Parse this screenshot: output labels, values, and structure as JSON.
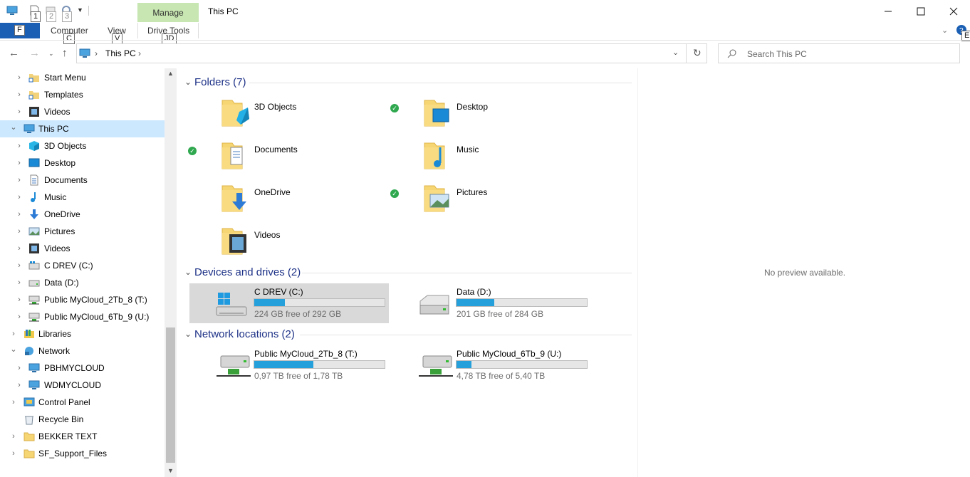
{
  "title_bar": {
    "title": "This PC",
    "manage_tab": "Manage",
    "qat_keytips": [
      "1",
      "2",
      "3"
    ],
    "window_controls": [
      "minimize-icon",
      "maximize-icon",
      "close-icon"
    ]
  },
  "ribbon": {
    "file_keytip": "F",
    "tabs": [
      {
        "label": "Computer",
        "keytip": "C"
      },
      {
        "label": "View",
        "keytip": "V"
      },
      {
        "label": "Drive Tools",
        "keytip": "JD"
      }
    ],
    "help_keytip": "E"
  },
  "address_bar": {
    "path": [
      "This PC"
    ],
    "search_placeholder": "Search This PC"
  },
  "nav_pane": {
    "items": [
      {
        "label": "Start Menu",
        "icon": "shortcut-folder-icon"
      },
      {
        "label": "Templates",
        "icon": "shortcut-folder-icon"
      },
      {
        "label": "Videos",
        "icon": "videos-icon"
      },
      {
        "label": "This PC",
        "icon": "computer-icon",
        "selected": true,
        "expanded": true
      },
      {
        "label": "3D Objects",
        "icon": "3d-objects-icon"
      },
      {
        "label": "Desktop",
        "icon": "desktop-icon"
      },
      {
        "label": "Documents",
        "icon": "documents-icon"
      },
      {
        "label": "Music",
        "icon": "music-icon"
      },
      {
        "label": "OneDrive",
        "icon": "onedrive-download-icon"
      },
      {
        "label": "Pictures",
        "icon": "pictures-icon"
      },
      {
        "label": "Videos",
        "icon": "videos-icon"
      },
      {
        "label": "C DREV (C:)",
        "icon": "windows-drive-icon"
      },
      {
        "label": "Data (D:)",
        "icon": "drive-icon"
      },
      {
        "label": "Public MyCloud_2Tb_8 (T:)",
        "icon": "network-drive-icon"
      },
      {
        "label": "Public MyCloud_6Tb_9 (U:)",
        "icon": "network-drive-icon"
      },
      {
        "label": "Libraries",
        "icon": "libraries-icon"
      },
      {
        "label": "Network",
        "icon": "network-icon",
        "expanded": true
      },
      {
        "label": "PBHMYCLOUD",
        "icon": "computer-icon"
      },
      {
        "label": "WDMYCLOUD",
        "icon": "computer-icon"
      },
      {
        "label": "Control Panel",
        "icon": "control-panel-icon"
      },
      {
        "label": "Recycle Bin",
        "icon": "recycle-bin-icon"
      },
      {
        "label": "BEKKER TEXT",
        "icon": "folder-icon"
      },
      {
        "label": "SF_Support_Files",
        "icon": "folder-icon"
      }
    ]
  },
  "content": {
    "folders_header": "Folders (7)",
    "folders": [
      {
        "label": "3D Objects",
        "synced": false
      },
      {
        "label": "Desktop",
        "synced": true
      },
      {
        "label": "Documents",
        "synced": true
      },
      {
        "label": "Music",
        "synced": false
      },
      {
        "label": "OneDrive",
        "synced": false
      },
      {
        "label": "Pictures",
        "synced": true
      },
      {
        "label": "Videos",
        "synced": false
      }
    ],
    "drives_header": "Devices and drives (2)",
    "drives": [
      {
        "label": "C DREV (C:)",
        "free": "224 GB free of 292 GB",
        "used_fraction": 0.233
      },
      {
        "label": "Data (D:)",
        "free": "201 GB free of 284 GB",
        "used_fraction": 0.292
      }
    ],
    "network_header": "Network locations (2)",
    "network": [
      {
        "label": "Public MyCloud_2Tb_8 (T:)",
        "free": "0,97 TB free of 1,78 TB",
        "used_fraction": 0.455
      },
      {
        "label": "Public MyCloud_6Tb_9 (U:)",
        "free": "4,78 TB free of 5,40 TB",
        "used_fraction": 0.115
      }
    ]
  },
  "preview_pane": {
    "text": "No preview available."
  },
  "colors": {
    "accent": "#1a5fb4",
    "selection": "#cce8ff",
    "manage_tab": "#c7e6b1",
    "bar_fill": "#26a0da",
    "sync_ok": "#2fa84f"
  }
}
